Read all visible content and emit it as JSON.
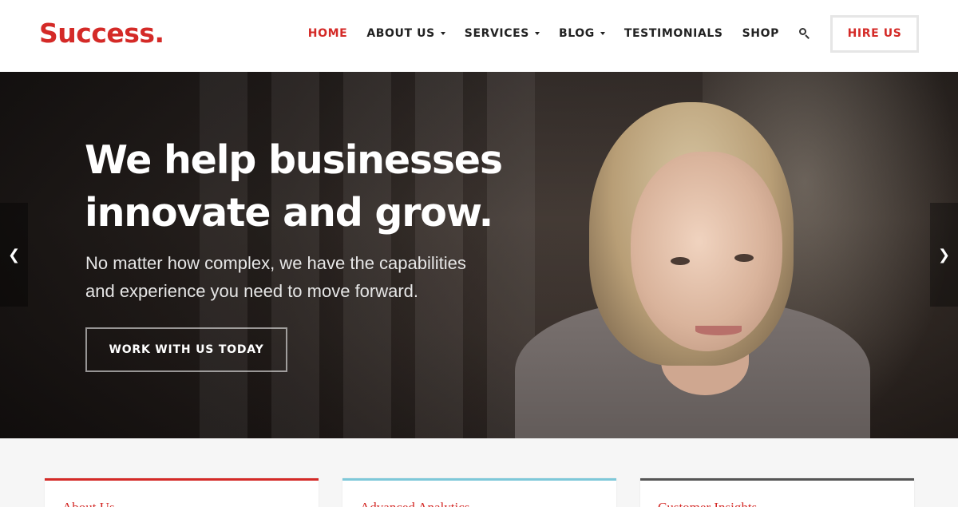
{
  "brand": {
    "logo_text": "Success.",
    "accent_color": "#d42a27"
  },
  "nav": {
    "items": [
      {
        "label": "HOME",
        "active": true,
        "dropdown": false
      },
      {
        "label": "ABOUT US",
        "active": false,
        "dropdown": true
      },
      {
        "label": "SERVICES",
        "active": false,
        "dropdown": true
      },
      {
        "label": "BLOG",
        "active": false,
        "dropdown": true
      },
      {
        "label": "TESTIMONIALS",
        "active": false,
        "dropdown": false
      },
      {
        "label": "SHOP",
        "active": false,
        "dropdown": false
      }
    ],
    "search_icon": "search-icon",
    "cta_label": "HIRE US"
  },
  "hero": {
    "title_line1": "We help businesses",
    "title_line2": "innovate and grow.",
    "subtitle_line1": "No matter how complex, we have the capabilities",
    "subtitle_line2": "and experience you need to move forward.",
    "button_label": "WORK WITH US TODAY",
    "prev_icon": "chevron-left-icon",
    "next_icon": "chevron-right-icon"
  },
  "features": {
    "cards": [
      {
        "title": "About Us",
        "color": "#d42a27"
      },
      {
        "title": "Advanced Analytics",
        "color": "#7ec8d9"
      },
      {
        "title": "Customer Insights",
        "color": "#555555"
      }
    ]
  }
}
